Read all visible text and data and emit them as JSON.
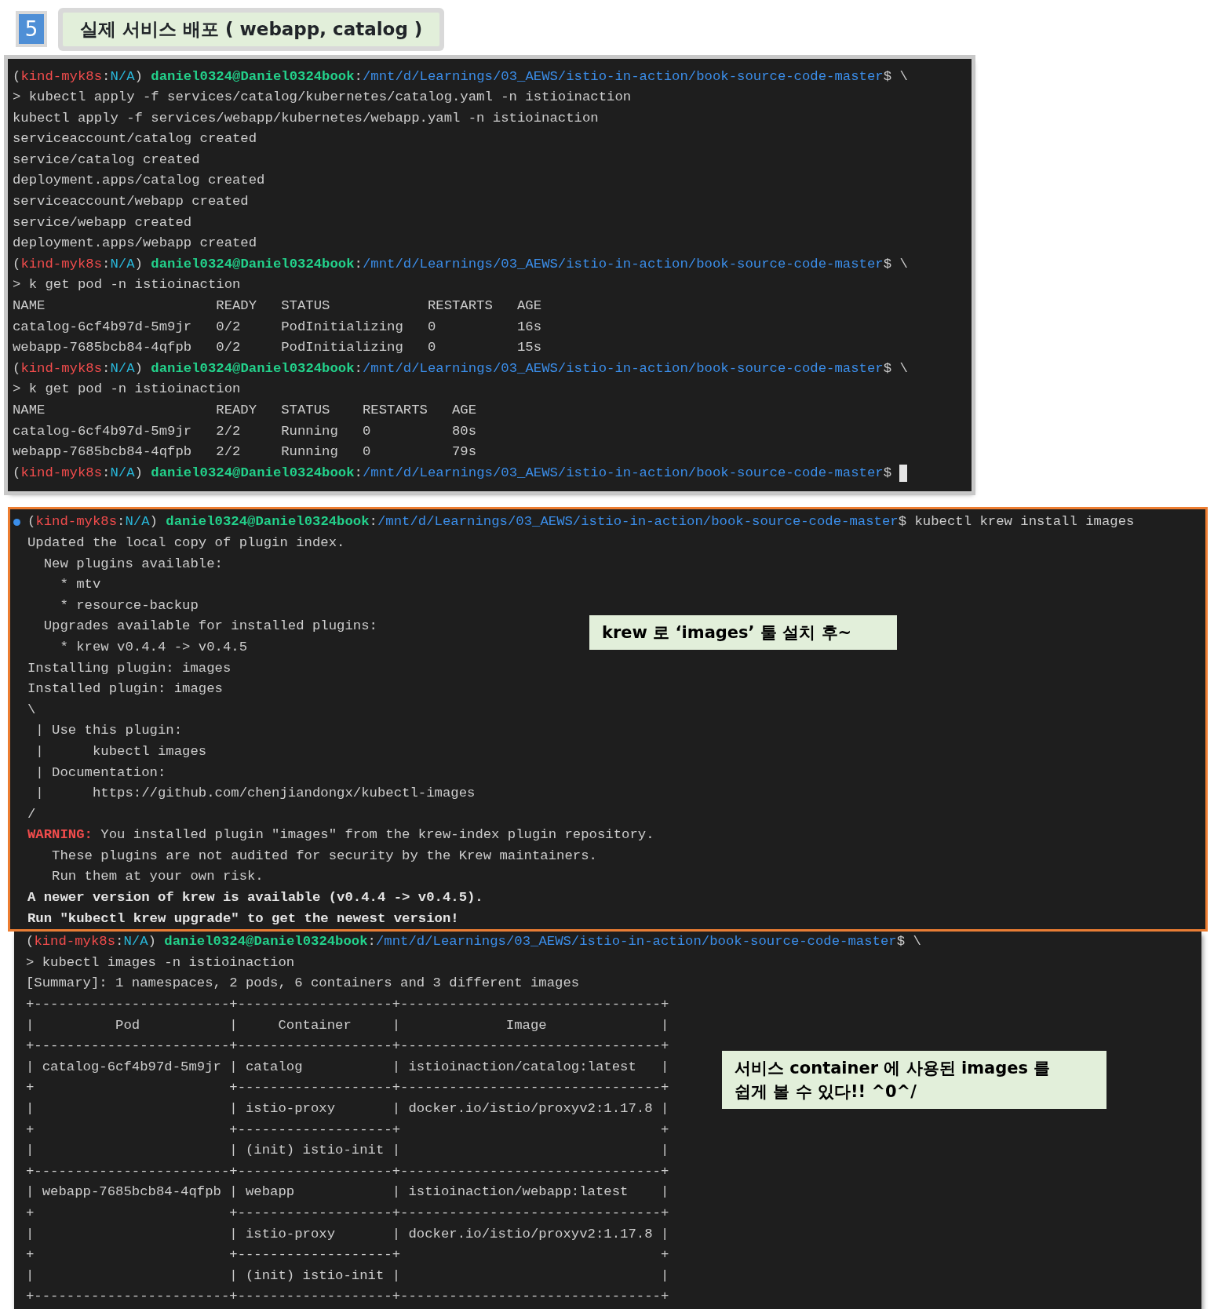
{
  "step": {
    "number": "5",
    "title": "실제 서비스 배포 ( webapp, catalog )"
  },
  "terminals": [
    {
      "lines": [
        {
          "segments": [
            {
              "kind": "plain",
              "text": "("
            },
            {
              "kind": "env",
              "text": "kind-myk8s"
            },
            {
              "kind": "plain",
              "text": ":"
            },
            {
              "kind": "ctx",
              "text": "N/A"
            },
            {
              "kind": "plain",
              "text": ") "
            },
            {
              "kind": "user",
              "text": "daniel0324@Daniel0324book"
            },
            {
              "kind": "plain",
              "text": ":"
            },
            {
              "kind": "path",
              "text": "/mnt/d/Learnings/03_AEWS/istio-in-action/book-source-code-master"
            },
            {
              "kind": "plain",
              "text": "$ \\"
            }
          ]
        },
        {
          "text": "> kubectl apply -f services/catalog/kubernetes/catalog.yaml -n istioinaction"
        },
        {
          "text": "kubectl apply -f services/webapp/kubernetes/webapp.yaml -n istioinaction"
        },
        {
          "text": "serviceaccount/catalog created"
        },
        {
          "text": "service/catalog created"
        },
        {
          "text": "deployment.apps/catalog created"
        },
        {
          "text": "serviceaccount/webapp created"
        },
        {
          "text": "service/webapp created"
        },
        {
          "text": "deployment.apps/webapp created"
        },
        {
          "segments": [
            {
              "kind": "plain",
              "text": "("
            },
            {
              "kind": "env",
              "text": "kind-myk8s"
            },
            {
              "kind": "plain",
              "text": ":"
            },
            {
              "kind": "ctx",
              "text": "N/A"
            },
            {
              "kind": "plain",
              "text": ") "
            },
            {
              "kind": "user",
              "text": "daniel0324@Daniel0324book"
            },
            {
              "kind": "plain",
              "text": ":"
            },
            {
              "kind": "path",
              "text": "/mnt/d/Learnings/03_AEWS/istio-in-action/book-source-code-master"
            },
            {
              "kind": "plain",
              "text": "$ \\"
            }
          ]
        },
        {
          "text": "> k get pod -n istioinaction"
        },
        {
          "text": "NAME                     READY   STATUS            RESTARTS   AGE"
        },
        {
          "text": "catalog-6cf4b97d-5m9jr   0/2     PodInitializing   0          16s"
        },
        {
          "text": "webapp-7685bcb84-4qfpb   0/2     PodInitializing   0          15s"
        },
        {
          "segments": [
            {
              "kind": "plain",
              "text": "("
            },
            {
              "kind": "env",
              "text": "kind-myk8s"
            },
            {
              "kind": "plain",
              "text": ":"
            },
            {
              "kind": "ctx",
              "text": "N/A"
            },
            {
              "kind": "plain",
              "text": ") "
            },
            {
              "kind": "user",
              "text": "daniel0324@Daniel0324book"
            },
            {
              "kind": "plain",
              "text": ":"
            },
            {
              "kind": "path",
              "text": "/mnt/d/Learnings/03_AEWS/istio-in-action/book-source-code-master"
            },
            {
              "kind": "plain",
              "text": "$ \\"
            }
          ]
        },
        {
          "text": "> k get pod -n istioinaction"
        },
        {
          "text": "NAME                     READY   STATUS    RESTARTS   AGE"
        },
        {
          "text": "catalog-6cf4b97d-5m9jr   2/2     Running   0          80s"
        },
        {
          "text": "webapp-7685bcb84-4qfpb   2/2     Running   0          79s"
        },
        {
          "cursor": true,
          "segments": [
            {
              "kind": "plain",
              "text": "("
            },
            {
              "kind": "env",
              "text": "kind-myk8s"
            },
            {
              "kind": "plain",
              "text": ":"
            },
            {
              "kind": "ctx",
              "text": "N/A"
            },
            {
              "kind": "plain",
              "text": ") "
            },
            {
              "kind": "user",
              "text": "daniel0324@Daniel0324book"
            },
            {
              "kind": "plain",
              "text": ":"
            },
            {
              "kind": "path",
              "text": "/mnt/d/Learnings/03_AEWS/istio-in-action/book-source-code-master"
            },
            {
              "kind": "plain",
              "text": "$"
            }
          ]
        }
      ]
    },
    {
      "framed_lines": [
        {
          "dot": true,
          "segments": [
            {
              "kind": "plain",
              "text": "("
            },
            {
              "kind": "env",
              "text": "kind-myk8s"
            },
            {
              "kind": "plain",
              "text": ":"
            },
            {
              "kind": "ctx",
              "text": "N/A"
            },
            {
              "kind": "plain",
              "text": ") "
            },
            {
              "kind": "user",
              "text": "daniel0324@Daniel0324book"
            },
            {
              "kind": "plain",
              "text": ":"
            },
            {
              "kind": "path",
              "text": "/mnt/d/Learnings/03_AEWS/istio-in-action/book-source-code-master"
            },
            {
              "kind": "plain",
              "text": "$ kubectl krew install images"
            }
          ]
        },
        {
          "text": "Updated the local copy of plugin index."
        },
        {
          "text": "  New plugins available:"
        },
        {
          "text": "    * mtv"
        },
        {
          "text": "    * resource-backup"
        },
        {
          "text": "  Upgrades available for installed plugins:"
        },
        {
          "text": "    * krew v0.4.4 -> v0.4.5"
        },
        {
          "text": "Installing plugin: images"
        },
        {
          "text": "Installed plugin: images"
        },
        {
          "text": "\\"
        },
        {
          "text": " | Use this plugin:"
        },
        {
          "text": " |      kubectl images"
        },
        {
          "text": " | Documentation:"
        },
        {
          "text": " |      https://github.com/chenjiandongx/kubectl-images"
        },
        {
          "text": "/"
        },
        {
          "segments": [
            {
              "kind": "warning",
              "text": "WARNING:"
            },
            {
              "kind": "plain",
              "text": " You installed plugin \"images\" from the krew-index plugin repository."
            }
          ]
        },
        {
          "text": "   These plugins are not audited for security by the Krew maintainers."
        },
        {
          "text": "   Run them at your own risk."
        },
        {
          "segments": [
            {
              "kind": "bold",
              "text": "A newer version of krew is available (v0.4.4 -> v0.4.5)."
            }
          ]
        },
        {
          "segments": [
            {
              "kind": "bold",
              "text": "Run \"kubectl krew upgrade\" to get the newest version!"
            }
          ]
        }
      ],
      "framed_note": "krew 로 ‘images’ 툴 설치 후~",
      "lines": [
        {
          "segments": [
            {
              "kind": "plain",
              "text": "("
            },
            {
              "kind": "env",
              "text": "kind-myk8s"
            },
            {
              "kind": "plain",
              "text": ":"
            },
            {
              "kind": "ctx",
              "text": "N/A"
            },
            {
              "kind": "plain",
              "text": ") "
            },
            {
              "kind": "user",
              "text": "daniel0324@Daniel0324book"
            },
            {
              "kind": "plain",
              "text": ":"
            },
            {
              "kind": "path",
              "text": "/mnt/d/Learnings/03_AEWS/istio-in-action/book-source-code-master"
            },
            {
              "kind": "plain",
              "text": "$ \\"
            }
          ]
        },
        {
          "text": "> kubectl images -n istioinaction"
        },
        {
          "text": "[Summary]: 1 namespaces, 2 pods, 6 containers and 3 different images"
        },
        {
          "text": "+------------------------+-------------------+--------------------------------+"
        },
        {
          "text": "|          Pod           |     Container     |             Image              |"
        },
        {
          "text": "+------------------------+-------------------+--------------------------------+"
        },
        {
          "text": "| catalog-6cf4b97d-5m9jr | catalog           | istioinaction/catalog:latest   |"
        },
        {
          "text": "+                        +-------------------+--------------------------------+"
        },
        {
          "text": "|                        | istio-proxy       | docker.io/istio/proxyv2:1.17.8 |"
        },
        {
          "text": "+                        +-------------------+                                +"
        },
        {
          "text": "|                        | (init) istio-init |                                |"
        },
        {
          "text": "+------------------------+-------------------+--------------------------------+"
        },
        {
          "text": "| webapp-7685bcb84-4qfpb | webapp            | istioinaction/webapp:latest    |"
        },
        {
          "text": "+                        +-------------------+--------------------------------+"
        },
        {
          "text": "|                        | istio-proxy       | docker.io/istio/proxyv2:1.17.8 |"
        },
        {
          "text": "+                        +-------------------+                                +"
        },
        {
          "text": "|                        | (init) istio-init |                                |"
        },
        {
          "text": "+------------------------+-------------------+--------------------------------+"
        }
      ],
      "note": "서비스 container 에 사용된 images 를\n쉽게 볼 수 있다!! ^0^/"
    }
  ]
}
